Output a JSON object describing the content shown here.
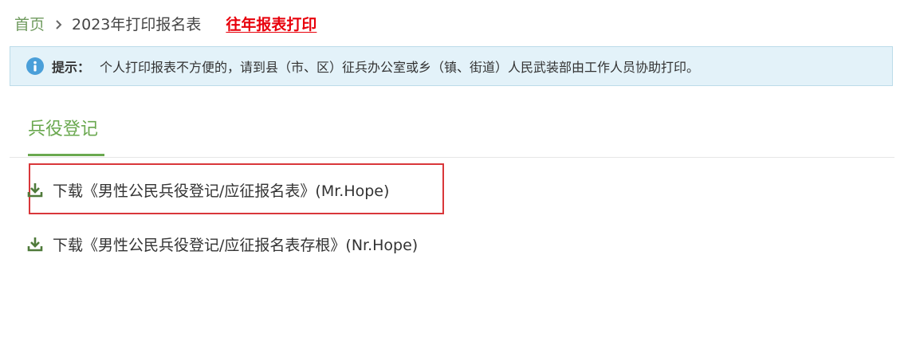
{
  "breadcrumb": {
    "home_label": "首页",
    "current_label": "2023年打印报名表",
    "history_link_label": "往年报表打印"
  },
  "notice": {
    "label": "提示：",
    "text": "个人打印报表不方便的，请到县（市、区）征兵办公室或乡（镇、街道）人民武装部由工作人员协助打印。",
    "icon": "info-icon"
  },
  "tabs": [
    {
      "label": "兵役登记",
      "active": true
    }
  ],
  "downloads": [
    {
      "label": "下载《男性公民兵役登记/应征报名表》(Mr.Hope)",
      "icon": "download-icon",
      "highlighted": true
    },
    {
      "label": "下载《男性公民兵役登记/应征报名表存根》(Nr.Hope)",
      "icon": "download-icon",
      "highlighted": false
    }
  ],
  "colors": {
    "accent_green": "#6aa84f",
    "breadcrumb_green": "#6f9a5e",
    "link_red": "#e8000b",
    "notice_bg": "#e3f2f9",
    "info_blue": "#4a9fd9",
    "highlight_red": "#d9373a",
    "download_icon_green": "#4f7a3a"
  }
}
